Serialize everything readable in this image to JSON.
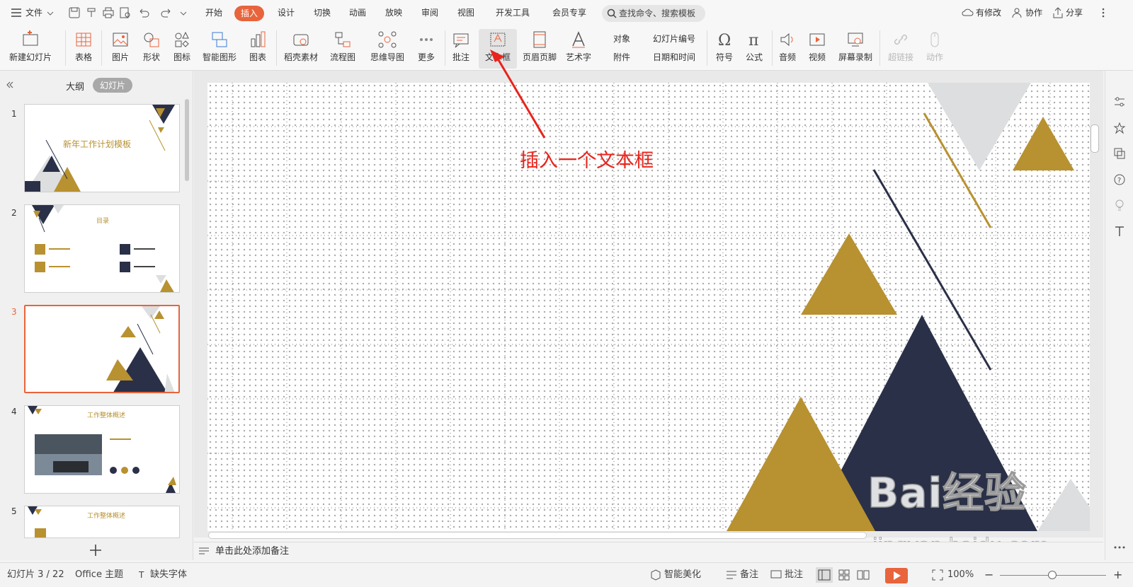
{
  "topbar": {
    "menu": "文件",
    "tabs": [
      "开始",
      "插入",
      "设计",
      "切换",
      "动画",
      "放映",
      "审阅",
      "视图",
      "开发工具",
      "会员专享"
    ],
    "active_tab": "插入",
    "search_placeholder": "查找命令、搜索模板",
    "has_changes": "有修改",
    "collab": "协作",
    "share": "分享"
  },
  "ribbon": {
    "new_slide": "新建幻灯片",
    "table": "表格",
    "picture": "图片",
    "shape": "形状",
    "icon": "图标",
    "smartart": "智能图形",
    "chart": "图表",
    "material": "稻壳素材",
    "flowchart": "流程图",
    "mindmap": "思维导图",
    "more": "更多",
    "comment": "批注",
    "textbox": "文本框",
    "header_footer": "页眉页脚",
    "wordart": "艺术字",
    "object": "对象",
    "attachment": "附件",
    "slide_number": "幻灯片编号",
    "datetime": "日期和时间",
    "symbol": "符号",
    "formula": "公式",
    "audio": "音频",
    "video": "视频",
    "screen_record": "屏幕录制",
    "hyperlink": "超链接",
    "action": "动作"
  },
  "panel": {
    "outline_tab": "大纲",
    "slides_tab": "幻灯片",
    "slide_numbers": [
      "1",
      "2",
      "3",
      "4",
      "5"
    ],
    "thumb1_title": "新年工作计划模板",
    "thumb2_title": "目录",
    "thumb4_title": "工作整体概述",
    "thumb5_title": "工作整体概述"
  },
  "annotation": {
    "text": "插入一个文本框",
    "color": "#e8241c"
  },
  "notes_placeholder": "单击此处添加备注",
  "status": {
    "slide_info": "幻灯片 3 / 22",
    "theme": "Office 主题",
    "missing_font": "缺失字体",
    "beautify": "智能美化",
    "notes": "备注",
    "comments": "批注",
    "zoom": "100%"
  },
  "watermark": {
    "brand": "Bai经验",
    "url": "jingyan.baidu.com"
  },
  "colors": {
    "accent": "#e8643c",
    "gold": "#b89130",
    "navy": "#2a3047",
    "gray": "#dcdedf"
  }
}
